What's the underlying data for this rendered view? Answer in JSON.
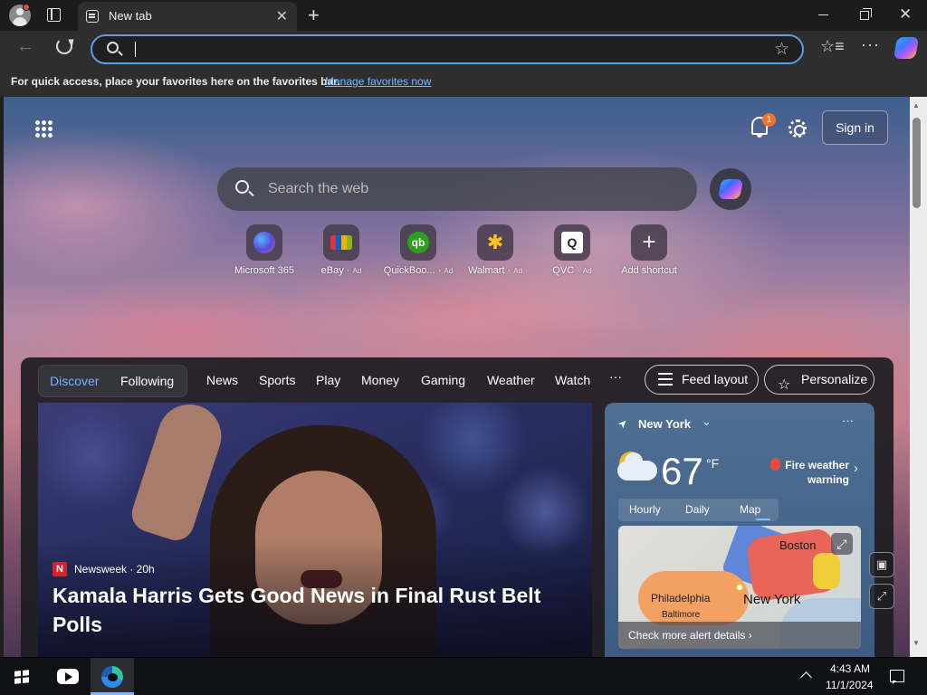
{
  "tab": {
    "title": "New tab"
  },
  "omnibox": {
    "value": ""
  },
  "favbar": {
    "text": "For quick access, place your favorites here on the favorites bar.",
    "link": "Manage favorites now"
  },
  "header": {
    "notification_count": "1",
    "signin_label": "Sign in"
  },
  "search": {
    "placeholder": "Search the web"
  },
  "shortcuts": [
    {
      "label": "Microsoft 365",
      "ad": "",
      "icon": "microsoft-365-icon"
    },
    {
      "label": "eBay",
      "ad": "Ad",
      "icon": "ebay-icon"
    },
    {
      "label": "QuickBoo...",
      "ad": "Ad",
      "icon": "quickbooks-icon",
      "glyph": "qb"
    },
    {
      "label": "Walmart",
      "ad": "Ad",
      "icon": "walmart-icon",
      "glyph": "✱"
    },
    {
      "label": "QVC",
      "ad": "Ad",
      "icon": "qvc-icon",
      "glyph": "Q"
    },
    {
      "label": "Add shortcut",
      "ad": "",
      "icon": "plus-icon",
      "glyph": "+"
    }
  ],
  "feed": {
    "tabs": [
      "Discover",
      "Following"
    ],
    "nav": [
      "News",
      "Sports",
      "Play",
      "Money",
      "Gaming",
      "Weather",
      "Watch"
    ],
    "more": "···",
    "feed_layout_label": "Feed layout",
    "personalize_label": "Personalize"
  },
  "hero": {
    "source_logo": "N",
    "source": "Newsweek · 20h",
    "headline": "Kamala Harris Gets Good News in Final Rust Belt Polls"
  },
  "weather": {
    "location": "New York",
    "temperature": "67",
    "unit": "°F",
    "alert": "Fire weather warning",
    "tabs": [
      "Hourly",
      "Daily",
      "Map"
    ],
    "selected_tab": "Map",
    "map_labels": {
      "boston": "Boston",
      "new_york": "New York",
      "philadelphia": "Philadelphia",
      "baltimore": "Baltimore"
    },
    "alert_details": "Check more alert details ›"
  },
  "taskbar": {
    "time": "4:43 AM",
    "date": "11/1/2024"
  },
  "colors": {
    "accent": "#5d9ce6",
    "link": "#7cb7ff",
    "discover": "#75b3ff",
    "badge": "#f2722b"
  }
}
